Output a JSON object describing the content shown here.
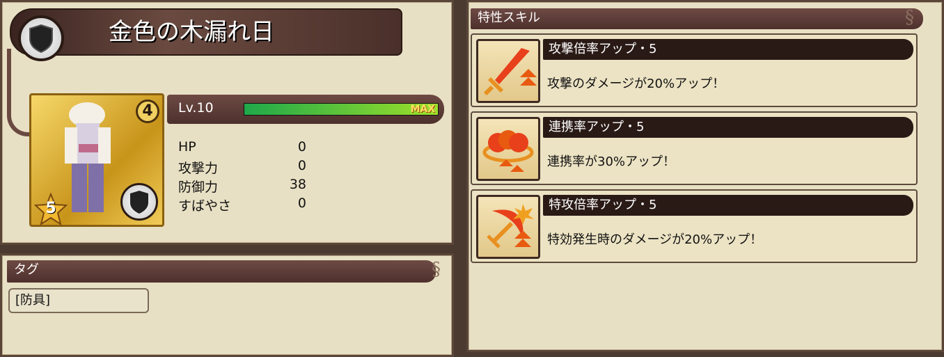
{
  "item": {
    "name": "金色の木漏れ日",
    "rank": "4",
    "stars": "5",
    "level": "Lv.10",
    "max_label": "MAX",
    "level_fill": 1.0
  },
  "stats": [
    {
      "label": "HP",
      "value": "0"
    },
    {
      "label": "攻撃力",
      "value": "0"
    },
    {
      "label": "防御力",
      "value": "38"
    },
    {
      "label": "すばやさ",
      "value": "0"
    }
  ],
  "tags": {
    "title": "タグ",
    "items": [
      "[防具]"
    ]
  },
  "skills": {
    "title": "特性スキル",
    "list": [
      {
        "name": "攻撃倍率アップ・5",
        "desc": "攻撃のダメージが20%アップ！",
        "icon": "sword-up-icon"
      },
      {
        "name": "連携率アップ・5",
        "desc": "連携率が30%アップ！",
        "icon": "chain-up-icon"
      },
      {
        "name": "特攻倍率アップ・5",
        "desc": "特効発生時のダメージが20%アップ！",
        "icon": "special-attack-up-icon"
      }
    ]
  },
  "colors": {
    "accent": "#4d302c",
    "bar_green": "#3cc84a",
    "gold": "#d4a820"
  }
}
